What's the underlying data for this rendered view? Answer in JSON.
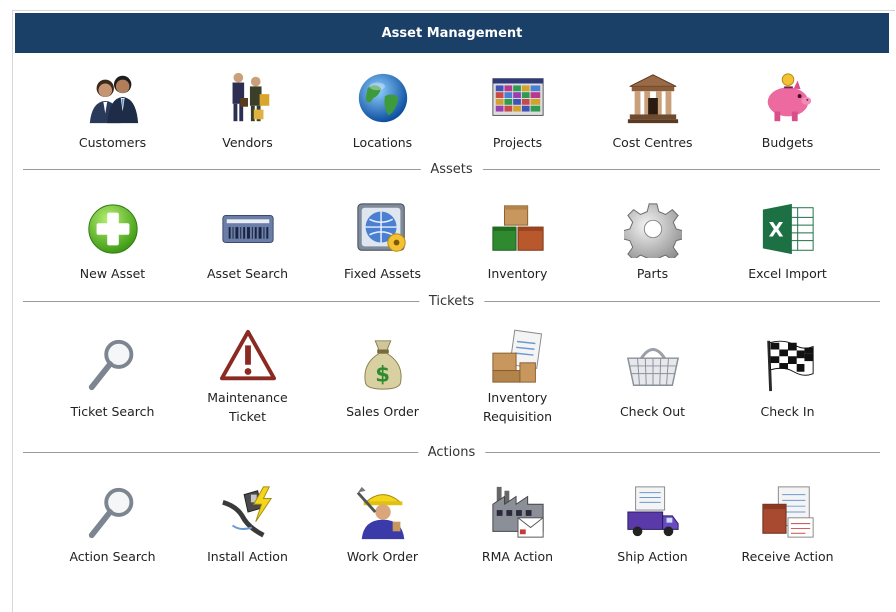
{
  "header": {
    "title": "Asset Management"
  },
  "sections": {
    "assets": "Assets",
    "tickets": "Tickets",
    "actions": "Actions"
  },
  "row1": [
    {
      "label": "Customers",
      "icon": "customers-icon"
    },
    {
      "label": "Vendors",
      "icon": "vendors-icon"
    },
    {
      "label": "Locations",
      "icon": "globe-icon"
    },
    {
      "label": "Projects",
      "icon": "projects-icon"
    },
    {
      "label": "Cost Centres",
      "icon": "bank-icon"
    },
    {
      "label": "Budgets",
      "icon": "piggy-bank-icon"
    }
  ],
  "row2": [
    {
      "label": "New Asset",
      "icon": "plus-icon"
    },
    {
      "label": "Asset Search",
      "icon": "barcode-icon"
    },
    {
      "label": "Fixed Assets",
      "icon": "fixed-assets-icon"
    },
    {
      "label": "Inventory",
      "icon": "boxes-icon"
    },
    {
      "label": "Parts",
      "icon": "gear-icon"
    },
    {
      "label": "Excel Import",
      "icon": "excel-icon"
    }
  ],
  "row3": [
    {
      "label": "Ticket Search",
      "icon": "magnifier-icon"
    },
    {
      "label": "Maintenance Ticket",
      "line1": "Maintenance",
      "line2": "Ticket",
      "icon": "warning-icon"
    },
    {
      "label": "Sales Order",
      "icon": "money-bag-icon"
    },
    {
      "label": "Inventory Requisition",
      "line1": "Inventory",
      "line2": "Requisition",
      "icon": "requisition-icon"
    },
    {
      "label": "Check Out",
      "icon": "basket-icon"
    },
    {
      "label": "Check In",
      "icon": "checkered-flag-icon"
    }
  ],
  "row4": [
    {
      "label": "Action Search",
      "icon": "magnifier-icon"
    },
    {
      "label": "Install Action",
      "icon": "install-cable-icon"
    },
    {
      "label": "Work Order",
      "icon": "worker-icon"
    },
    {
      "label": "RMA Action",
      "icon": "factory-icon"
    },
    {
      "label": "Ship Action",
      "icon": "truck-icon"
    },
    {
      "label": "Receive Action",
      "icon": "receive-document-icon"
    }
  ],
  "colors": {
    "header_bg": "#1b4068",
    "header_text": "#ffffff",
    "divider": "#9a9a9a"
  }
}
